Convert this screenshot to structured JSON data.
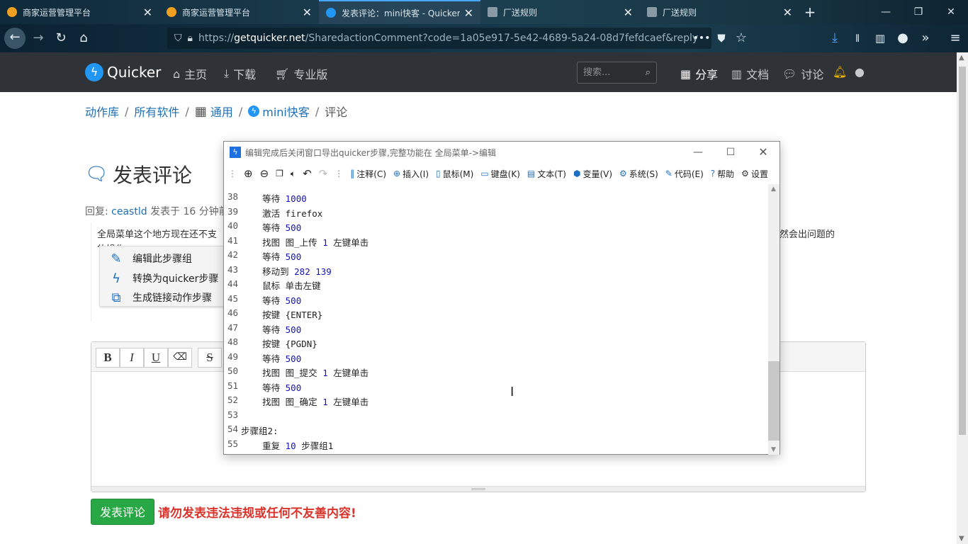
{
  "browser": {
    "tabs": [
      {
        "title": "商家运营管理平台",
        "active": false
      },
      {
        "title": "商家运营管理平台",
        "active": false
      },
      {
        "title": "发表评论：mini快客 - Quicker",
        "active": true
      },
      {
        "title": "厂送规则",
        "active": false
      },
      {
        "title": "厂送规则",
        "active": false
      }
    ],
    "url_prefix": "https://",
    "url_host": "getquicker.net",
    "url_path": "/SharedactionComment?code=1a05e917-5e42-4689-5a24-08d7fefdcaef&reply"
  },
  "site": {
    "logo_text": "Quicker",
    "nav": [
      {
        "label": "主页",
        "icon": "home-icon"
      },
      {
        "label": "下载",
        "icon": "download-icon"
      },
      {
        "label": "专业版",
        "icon": "cart-icon"
      }
    ],
    "search_placeholder": "搜索...",
    "right_nav": [
      {
        "label": "分享",
        "icon": "windows-icon"
      },
      {
        "label": "文档",
        "icon": "books-icon"
      },
      {
        "label": "讨论",
        "icon": "comments-icon"
      }
    ]
  },
  "breadcrumb": {
    "items": [
      "动作库",
      "所有软件",
      "通用",
      "mini快客",
      "评论"
    ],
    "separator": "/"
  },
  "page": {
    "title": "发表评论",
    "reply_prefix": "回复",
    "reply_user": "ceastld",
    "reply_time": "发表于 16 分钟前",
    "quote_line1": "全局菜单这个地方现在还不支",
    "quote_line2": "的操作",
    "quote_right": "然会出问题的",
    "context_menu": [
      {
        "label": "编辑此步骤组",
        "icon": "pencil-icon"
      },
      {
        "label": "转换为quicker步骤",
        "icon": "bolt-icon"
      },
      {
        "label": "生成链接动作步骤",
        "icon": "external-link-icon"
      }
    ],
    "format_buttons": [
      "B",
      "I",
      "U",
      "⌫",
      "S"
    ],
    "submit_label": "发表评论",
    "warning": "请勿发表违法违规或任何不友善内容!"
  },
  "editor_window": {
    "title": "编辑完成后关闭窗口导出quicker步骤,完整功能在 全局菜单->编辑",
    "toolbar": [
      {
        "label": "注释(C)",
        "icon": "comment-bars-icon"
      },
      {
        "label": "插入(I)",
        "icon": "plus-circle-icon"
      },
      {
        "label": "鼠标(M)",
        "icon": "mouse-icon"
      },
      {
        "label": "键盘(K)",
        "icon": "keyboard-icon"
      },
      {
        "label": "文本(T)",
        "icon": "file-text-icon"
      },
      {
        "label": "变量(V)",
        "icon": "cube-icon"
      },
      {
        "label": "系统(S)",
        "icon": "gear-icon"
      },
      {
        "label": "代码(E)",
        "icon": "pencil-icon"
      },
      {
        "label": "帮助",
        "icon": "question-icon"
      },
      {
        "label": "设置",
        "icon": "settings-icon"
      }
    ],
    "lines": [
      {
        "n": "38",
        "cmd": "    等待 ",
        "arg": "1000",
        "rest": ""
      },
      {
        "n": "39",
        "cmd": "    激活 firefox",
        "arg": "",
        "rest": ""
      },
      {
        "n": "40",
        "cmd": "    等待 ",
        "arg": "500",
        "rest": ""
      },
      {
        "n": "41",
        "cmd": "    找图 图_上传 ",
        "arg": "1",
        "rest": " 左键单击"
      },
      {
        "n": "42",
        "cmd": "    等待 ",
        "arg": "500",
        "rest": ""
      },
      {
        "n": "43",
        "cmd": "    移动到 ",
        "arg": "282 139",
        "rest": ""
      },
      {
        "n": "44",
        "cmd": "    鼠标 单击左键",
        "arg": "",
        "rest": ""
      },
      {
        "n": "45",
        "cmd": "    等待 ",
        "arg": "500",
        "rest": ""
      },
      {
        "n": "46",
        "cmd": "    按键 {ENTER}",
        "arg": "",
        "rest": ""
      },
      {
        "n": "47",
        "cmd": "    等待 ",
        "arg": "500",
        "rest": ""
      },
      {
        "n": "48",
        "cmd": "    按键 {PGDN}",
        "arg": "",
        "rest": ""
      },
      {
        "n": "49",
        "cmd": "    等待 ",
        "arg": "500",
        "rest": ""
      },
      {
        "n": "50",
        "cmd": "    找图 图_提交 ",
        "arg": "1",
        "rest": " 左键单击"
      },
      {
        "n": "51",
        "cmd": "    等待 ",
        "arg": "500",
        "rest": ""
      },
      {
        "n": "52",
        "cmd": "    找图 图_确定 ",
        "arg": "1",
        "rest": " 左键单击"
      },
      {
        "n": "53",
        "cmd": "",
        "arg": "",
        "rest": ""
      },
      {
        "n": "54",
        "cmd": "步骤组2:",
        "arg": "",
        "rest": ""
      },
      {
        "n": "55",
        "cmd": "    重复 ",
        "arg": "10",
        "rest": " 步骤组1"
      }
    ]
  },
  "colors": {
    "accent": "#1f6fb5",
    "header_bg": "#2f3236",
    "submit_green": "#28a745",
    "warning_red": "#d9342b",
    "code_number": "#1414b8"
  }
}
